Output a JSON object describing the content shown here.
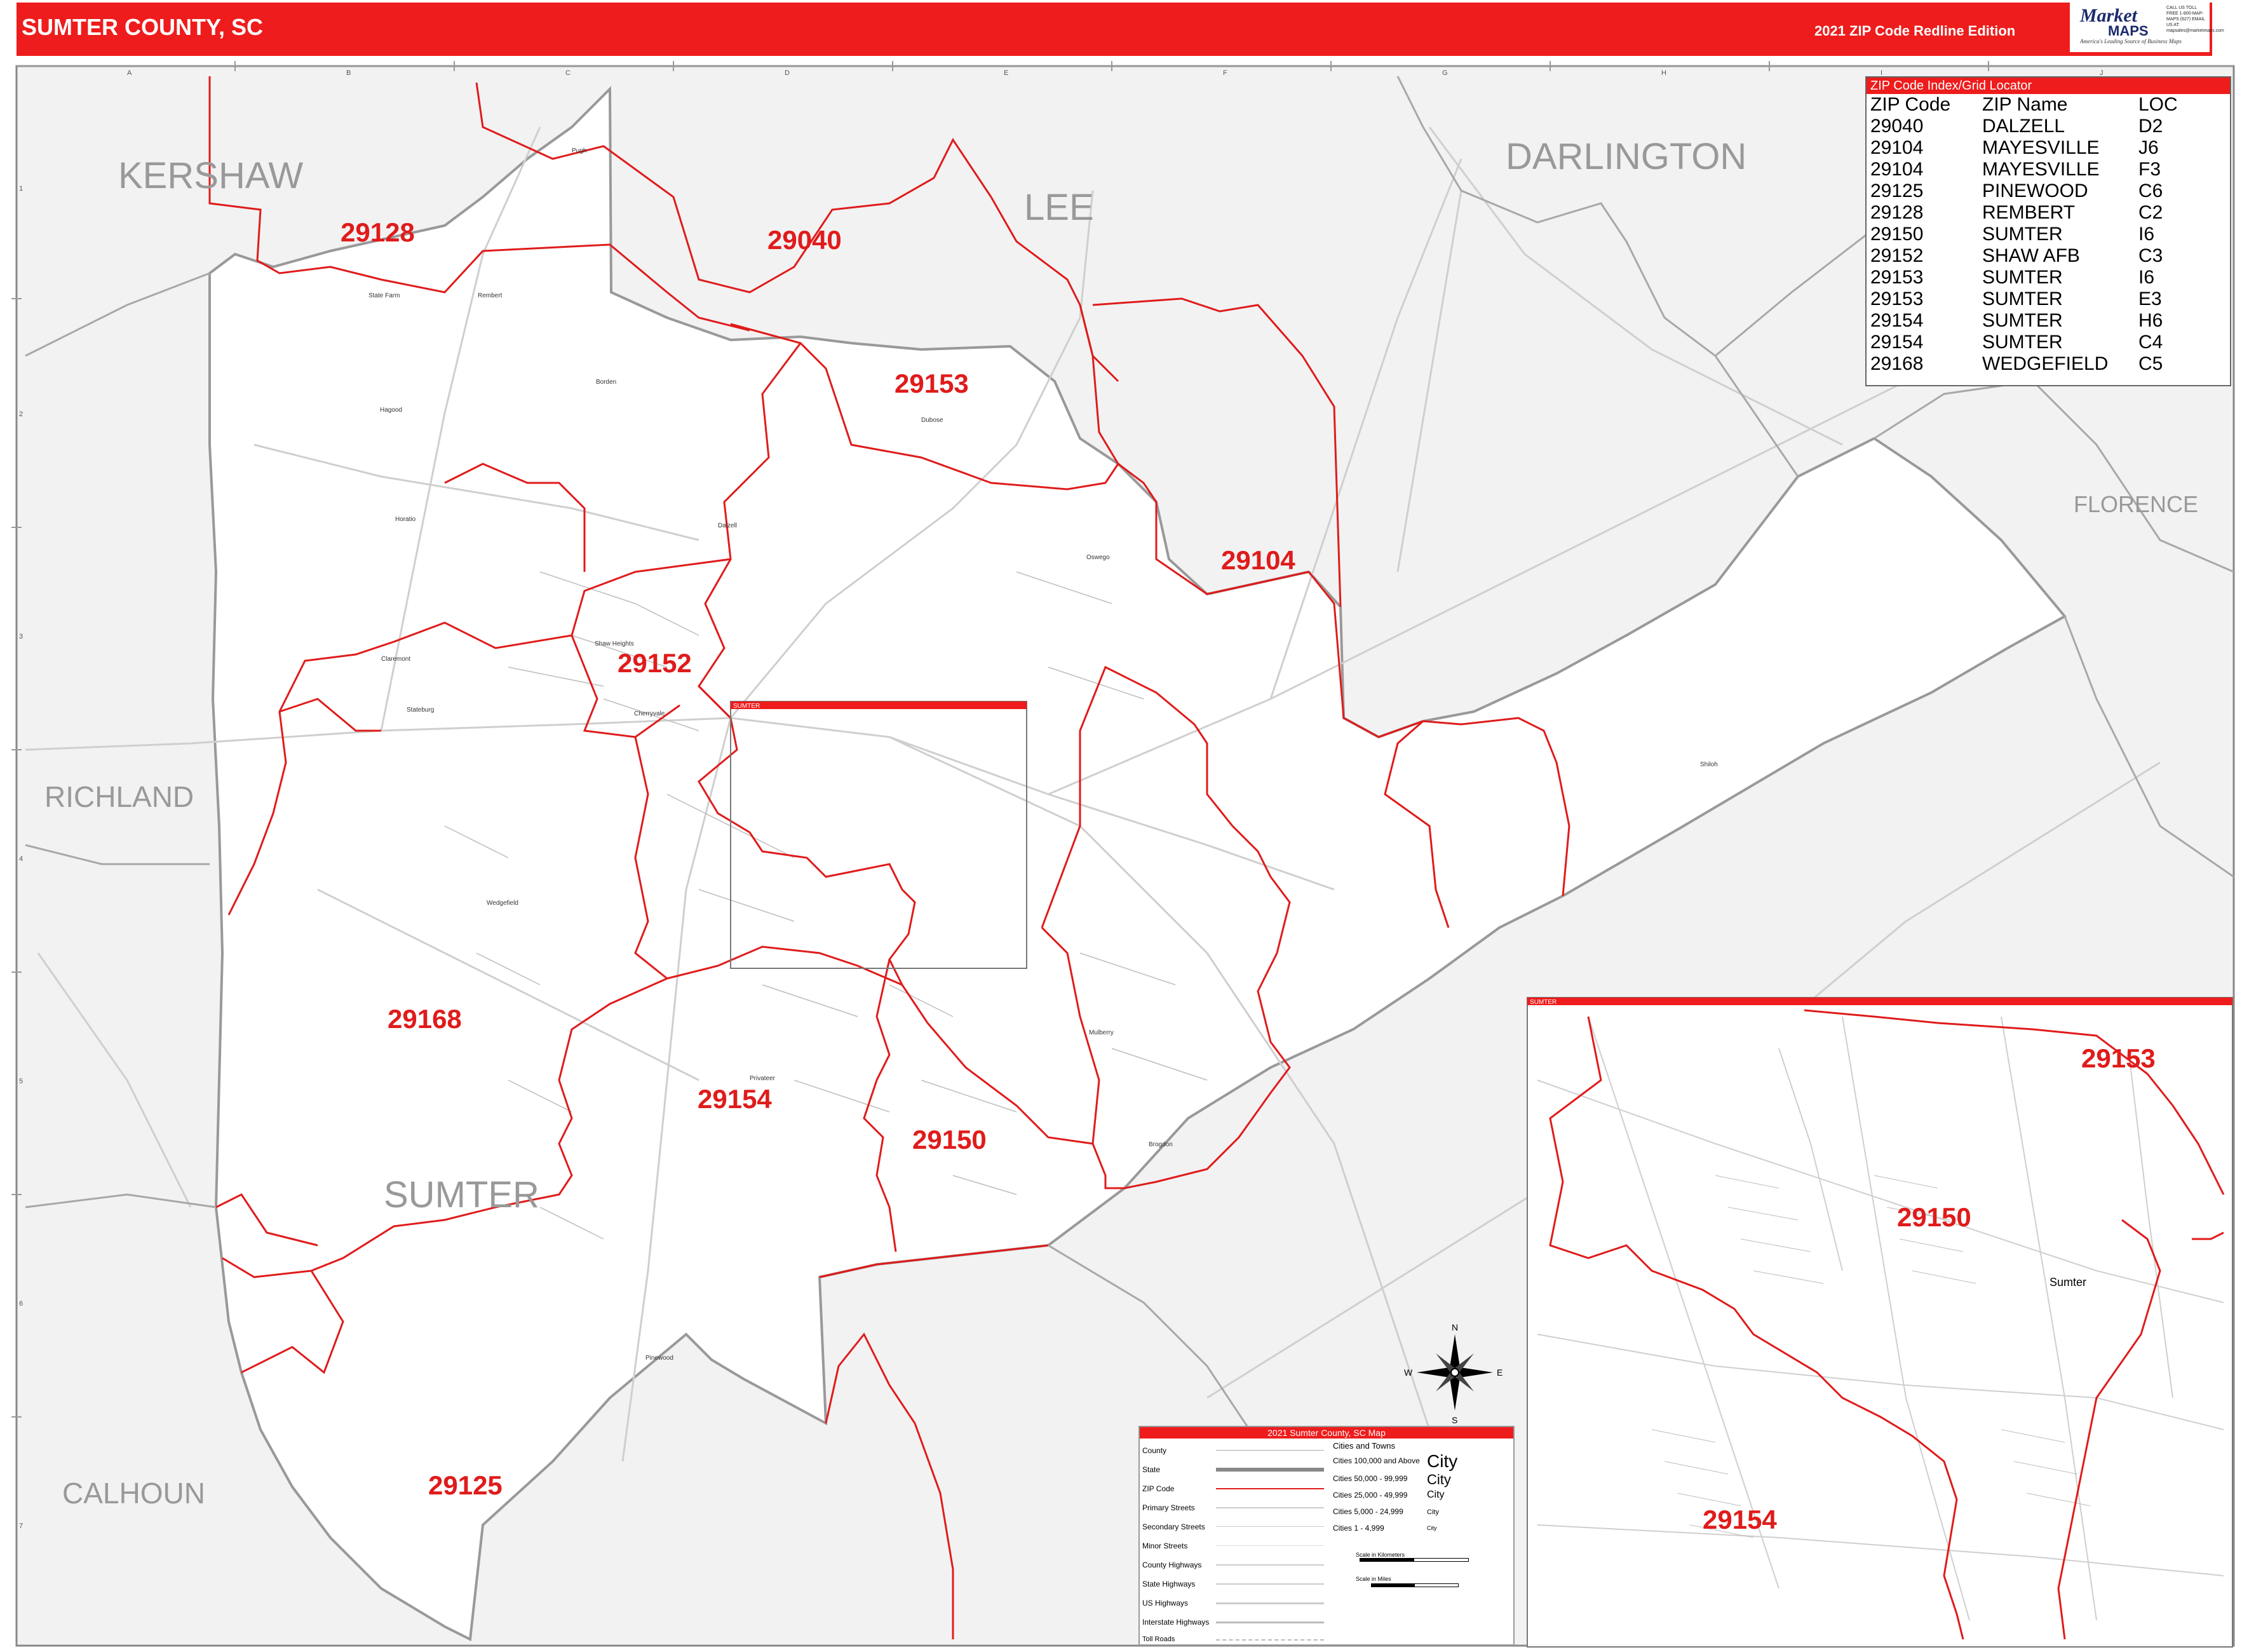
{
  "header": {
    "title": "SUMTER COUNTY, SC",
    "edition": "2021 ZIP Code Redline Edition"
  },
  "logo": {
    "brand": "Market",
    "brand2": "MAPS",
    "tagline": "On Target, On Time.",
    "subtag": "America's Leading Source of Business Maps",
    "contact": "CALL US TOLL FREE 1-800-MAP-MAPS (627) EMAIL US AT: mapsales@marketmaps.com"
  },
  "colors": {
    "accent_red": "#ee1c1c",
    "zip_boundary": "#e01b1b",
    "county_boundary": "#9a9a9a",
    "outside_fill": "#f2f2f2"
  },
  "counties": {
    "kershaw": "KERSHAW",
    "lee": "LEE",
    "darlington": "DARLINGTON",
    "florence": "FLORENCE",
    "richland": "RICHLAND",
    "sumter": "SUMTER",
    "calhoun": "CALHOUN"
  },
  "zip_labels": {
    "z29128": "29128",
    "z29040": "29040",
    "z29153": "29153",
    "z29104": "29104",
    "z29152": "29152",
    "z29168": "29168",
    "z29154": "29154",
    "z29150": "29150",
    "z29125": "29125"
  },
  "inset": {
    "label": "SUMTER",
    "box_label": "SUMTER",
    "z29153": "29153",
    "z29150": "29150",
    "z29154": "29154",
    "city": "Sumter"
  },
  "grid": {
    "columns": [
      "A",
      "B",
      "C",
      "D",
      "E",
      "F",
      "G",
      "H",
      "I",
      "J"
    ],
    "rows": [
      "1",
      "2",
      "3",
      "4",
      "5",
      "6",
      "7"
    ]
  },
  "zip_index": {
    "title": "ZIP Code Index/Grid Locator",
    "headers": [
      "ZIP Code",
      "ZIP Name",
      "LOC"
    ],
    "rows": [
      [
        "29040",
        "DALZELL",
        "D2"
      ],
      [
        "29104",
        "MAYESVILLE",
        "J6"
      ],
      [
        "29104",
        "MAYESVILLE",
        "F3"
      ],
      [
        "29125",
        "PINEWOOD",
        "C6"
      ],
      [
        "29128",
        "REMBERT",
        "C2"
      ],
      [
        "29150",
        "SUMTER",
        "I6"
      ],
      [
        "29152",
        "SHAW AFB",
        "C3"
      ],
      [
        "29153",
        "SUMTER",
        "I6"
      ],
      [
        "29153",
        "SUMTER",
        "E3"
      ],
      [
        "29154",
        "SUMTER",
        "H6"
      ],
      [
        "29154",
        "SUMTER",
        "C4"
      ],
      [
        "29168",
        "WEDGEFIELD",
        "C5"
      ]
    ]
  },
  "legend": {
    "title": "2021 Sumter County, SC Map",
    "items": [
      "County",
      "State",
      "ZIP Code",
      "Primary Streets",
      "Secondary Streets",
      "Minor Streets",
      "County Highways",
      "State Highways",
      "US Highways",
      "Interstate Highways",
      "Toll Roads"
    ],
    "cities_title": "Cities and Towns",
    "city_classes": [
      {
        "range": "Cities 100,000 and Above",
        "sample": "City"
      },
      {
        "range": "Cities 50,000 - 99,999",
        "sample": "City"
      },
      {
        "range": "Cities 25,000 - 49,999",
        "sample": "City"
      },
      {
        "range": "Cities 5,000 - 24,999",
        "sample": "City"
      },
      {
        "range": "Cities 1 - 4,999",
        "sample": "City"
      }
    ],
    "scale_km": "Scale in Kilometers",
    "scale_mi": "Scale in Miles"
  },
  "compass": {
    "n": "N",
    "s": "S",
    "e": "E",
    "w": "W"
  },
  "places": [
    "Pugh",
    "Rembert",
    "State Farm",
    "Borden",
    "Hagood",
    "Dubose",
    "Oswego",
    "Stateburg",
    "Dalzell",
    "Shaw Heights",
    "Cherryvale",
    "Wedgefield",
    "Pinewood",
    "Privateer",
    "Brogdon",
    "Shiloh",
    "Claremont",
    "Horatio",
    "Sumter",
    "Mulberry"
  ]
}
